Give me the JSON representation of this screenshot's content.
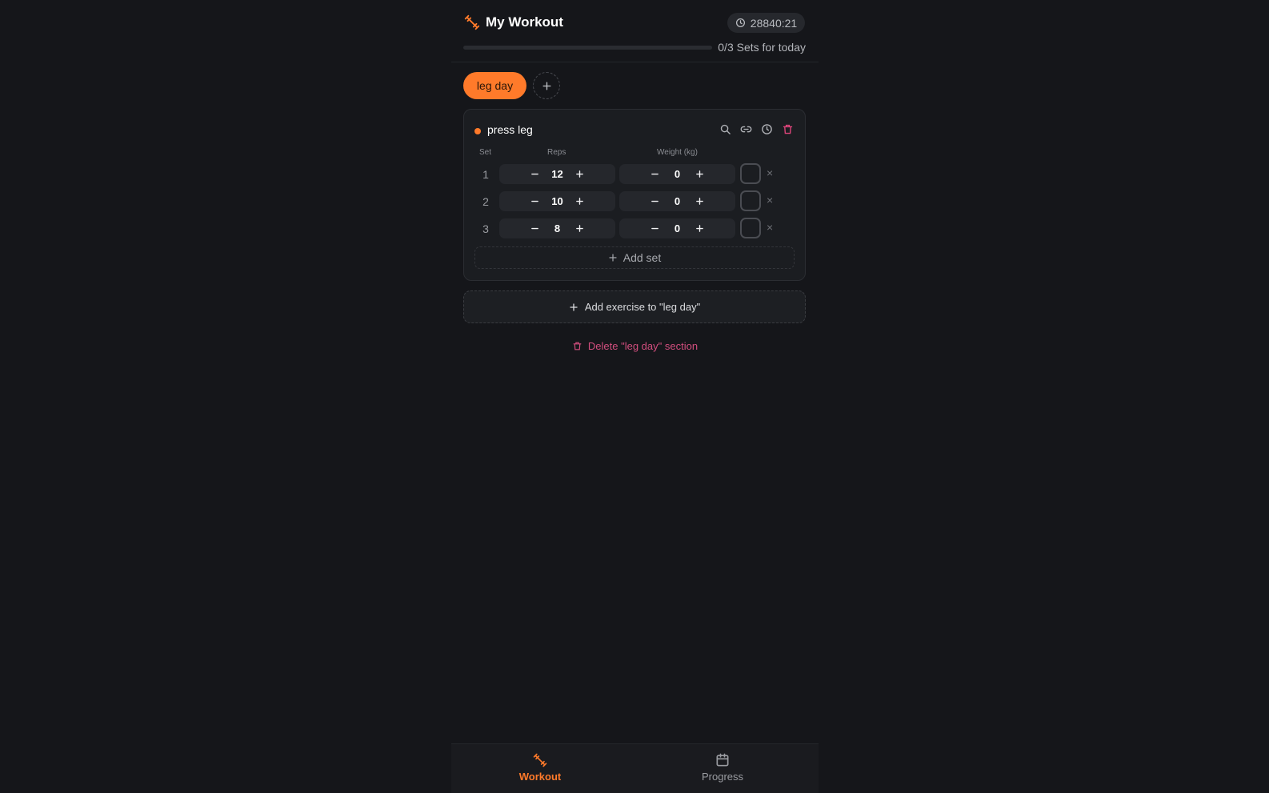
{
  "header": {
    "title": "My Workout",
    "timer": "28840:21",
    "progress_label": "0/3 Sets for today",
    "progress_fraction": 0
  },
  "sections": [
    {
      "label": "leg day",
      "active": true
    }
  ],
  "exercise": {
    "name": "press leg",
    "columns": {
      "set": "Set",
      "reps": "Reps",
      "weight": "Weight (kg)"
    },
    "sets": [
      {
        "num": "1",
        "reps": "12",
        "weight": "0"
      },
      {
        "num": "2",
        "reps": "10",
        "weight": "0"
      },
      {
        "num": "3",
        "reps": "8",
        "weight": "0"
      }
    ],
    "add_set_label": "Add set",
    "remove_glyph": "×"
  },
  "add_exercise_label": "Add exercise to \"leg day\"",
  "delete_section_label": "Delete \"leg day\" section",
  "nav": {
    "workout": "Workout",
    "progress": "Progress"
  },
  "colors": {
    "accent": "#ff7a2a",
    "danger": "#d24e7e",
    "background": "#15161a"
  },
  "icons": [
    "dumbbell-icon",
    "clock-icon",
    "plus-icon",
    "search-icon",
    "link-icon",
    "history-icon",
    "trash-icon",
    "minus-icon",
    "calendar-icon",
    "close-icon"
  ]
}
